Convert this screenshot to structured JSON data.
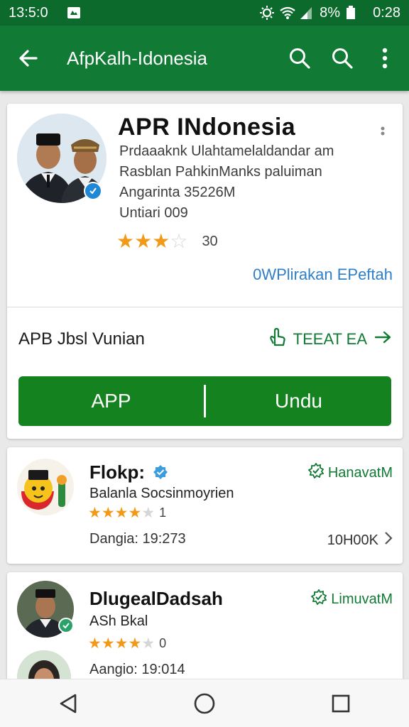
{
  "status_bar": {
    "time_left": "13:5:0",
    "battery": "8%",
    "time_right": "0:28"
  },
  "app_bar": {
    "title": "AfpKalh-Idonesia",
    "icons": [
      "back-arrow-icon",
      "search-icon",
      "search-icon",
      "more-vert-icon"
    ]
  },
  "main_card": {
    "title": "APR INdonesia",
    "info_lines": [
      "Prdaaaknk Ulahtamelaldandar am",
      "Rasblan PahkinManks paluiman",
      "Angarinta 35226M",
      "Untiari 009"
    ],
    "rating": {
      "stars": 3,
      "max": 5,
      "count": "30"
    },
    "link": "0WPlirakan EPeftah",
    "section_label": "APB Jbsl Vunian",
    "section_action": "TEEAT EA",
    "button_left": "APP",
    "button_right": "Undu"
  },
  "items": [
    {
      "title": "Flokp:",
      "subtitle": "Balanla Socsinmoyrien",
      "rating": {
        "stars": 4,
        "max": 5,
        "count": "1"
      },
      "meta": "Dangia: 19:273",
      "action": "HanavatM",
      "right_meta": "10H00K"
    },
    {
      "title": "DlugealDadsah",
      "subtitle": "ASh Bkal",
      "rating": {
        "stars": 4,
        "max": 5,
        "count": "0"
      },
      "meta": "Aangio: 19:014",
      "action": "LimuvatM"
    }
  ],
  "colors": {
    "status_bar": "#0c6b2c",
    "app_bar": "#117a35",
    "button": "#13821f",
    "link": "#2f7fc8",
    "star": "#f29a18"
  }
}
